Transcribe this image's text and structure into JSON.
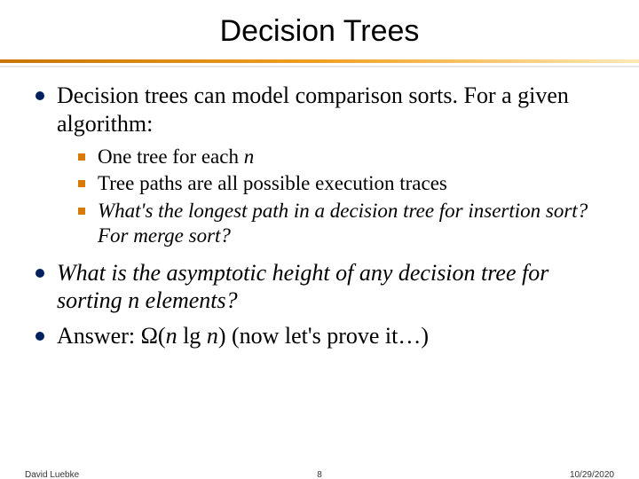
{
  "title": "Decision Trees",
  "bullets": {
    "b1": "Decision trees can model comparison sorts.  For a given algorithm:",
    "sub1_a": "One tree for each ",
    "sub1_b": "n",
    "sub2": "Tree paths are all possible execution traces",
    "sub3": "What's the longest path in a decision tree for insertion sort?  For merge sort?",
    "b2": "What is the asymptotic height of any decision tree for sorting n elements?",
    "b3_a": "Answer: Ω(",
    "b3_b": "n",
    "b3_c": " lg ",
    "b3_d": "n",
    "b3_e": ")    (now let's prove it…)"
  },
  "footer": {
    "author": "David Luebke",
    "page": "8",
    "date": "10/29/2020"
  }
}
